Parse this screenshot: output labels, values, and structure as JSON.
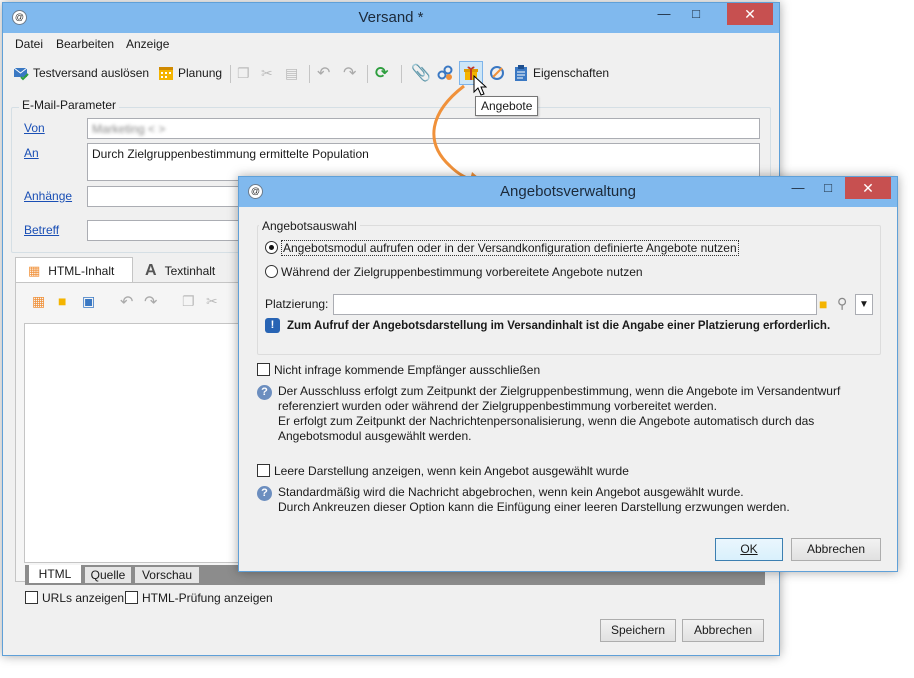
{
  "main_window": {
    "title": "Versand *",
    "menu": [
      "Datei",
      "Bearbeiten",
      "Anzeige"
    ],
    "toolbar": {
      "test_send_label": "Testversand auslösen",
      "schedule_label": "Planung",
      "properties_label": "Eigenschaften",
      "tooltip": "Angebote"
    },
    "email_params": {
      "group_label": "E-Mail-Parameter",
      "from_label": "Von",
      "from_value": "Marketing < >",
      "to_label": "An",
      "to_value": "Durch Zielgruppenbestimmung ermittelte Population",
      "attachments_label": "Anhänge",
      "subject_label": "Betreff"
    },
    "content_tabs": [
      "HTML-Inhalt",
      "Textinhalt"
    ],
    "bottom_tabs": [
      "HTML",
      "Quelle",
      "Vorschau"
    ],
    "options": {
      "show_urls": "URLs anzeigen",
      "html_check": "HTML-Prüfung anzeigen"
    },
    "buttons": {
      "save": "Speichern",
      "cancel": "Abbrechen"
    }
  },
  "dialog": {
    "title": "Angebotsverwaltung",
    "offer_selection": {
      "group_label": "Angebotsauswahl",
      "radio_1": "Angebotsmodul aufrufen oder in der Versandkonfiguration definierte Angebote nutzen",
      "radio_2": "Während der Zielgruppenbestimmung vorbereitete Angebote nutzen",
      "placement_label": "Platzierung:",
      "placement_value": "",
      "warning": "Zum Aufruf der Angebotsdarstellung im Versandinhalt ist die Angabe einer Platzierung erforderlich."
    },
    "exclude": {
      "label": "Nicht infrage kommende Empfänger ausschließen",
      "help_lines": [
        "Der Ausschluss erfolgt zum Zeitpunkt der Zielgruppenbestimmung, wenn die Angebote im Versandentwurf",
        "referenziert wurden oder während der Zielgruppenbestimmung vorbereitet werden.",
        "Er erfolgt zum Zeitpunkt der Nachrichtenpersonalisierung, wenn die Angebote automatisch durch das",
        "Angebotsmodul ausgewählt werden."
      ]
    },
    "empty": {
      "label": "Leere Darstellung anzeigen, wenn kein Angebot ausgewählt wurde",
      "help_lines": [
        "Standardmäßig wird die Nachricht abgebrochen, wenn kein Angebot ausgewählt wurde.",
        "Durch Ankreuzen dieser Option kann die Einfügung einer leeren Darstellung erzwungen werden."
      ]
    },
    "buttons": {
      "ok": "OK",
      "cancel": "Abbrechen"
    }
  },
  "colors": {
    "titlebar": "#80b9ee",
    "close": "#c75050",
    "arrow": "#f0913a",
    "link": "#1a4fb5"
  }
}
